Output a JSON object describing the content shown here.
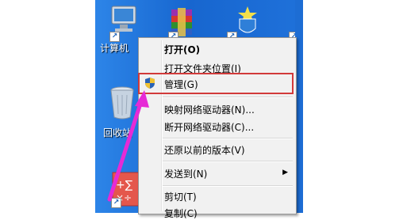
{
  "desktop": {
    "icons": [
      {
        "name": "computer",
        "label": "计算机"
      },
      {
        "name": "recycle-bin",
        "label": "回收站"
      }
    ]
  },
  "context_menu": {
    "items": [
      {
        "label": "打开(O)",
        "bold": true
      },
      {
        "label": "打开文件夹位置(I)"
      },
      {
        "label": "管理(G)",
        "highlighted": true
      },
      {
        "label": "映射网络驱动器(N)..."
      },
      {
        "label": "断开网络驱动器(C)..."
      },
      {
        "label": "还原以前的版本(V)"
      },
      {
        "label": "发送到(N)",
        "submenu": true
      },
      {
        "label": "剪切(T)"
      },
      {
        "label": "复制(C)"
      }
    ]
  },
  "colors": {
    "desktop_blue": "#1a6fd6",
    "menu_bg": "#f1f1f1",
    "highlight_red": "#d23a3a",
    "arrow_magenta": "#e62ad6"
  }
}
